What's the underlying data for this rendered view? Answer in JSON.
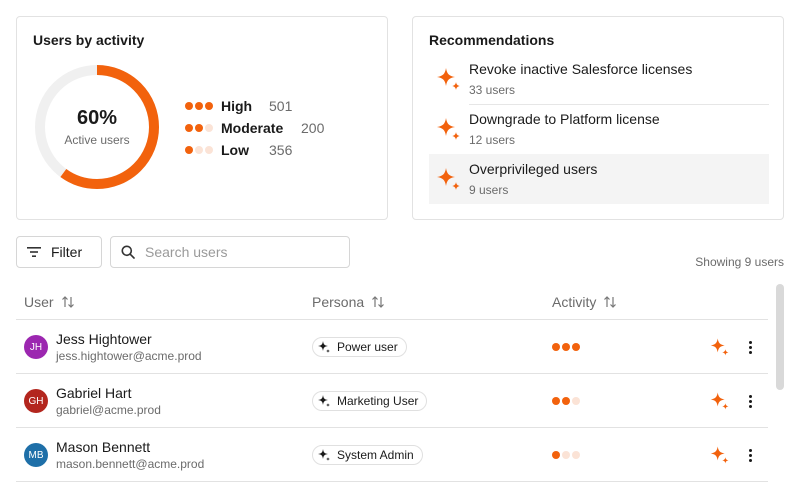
{
  "activity_card": {
    "title": "Users by activity",
    "donut_value": "60%",
    "donut_caption": "Active users",
    "active_fraction": 0.6,
    "legend": [
      {
        "label": "High",
        "count": "501",
        "level": 3
      },
      {
        "label": "Moderate",
        "count": "200",
        "level": 2
      },
      {
        "label": "Low",
        "count": "356",
        "level": 1
      }
    ]
  },
  "recommendations": {
    "title": "Recommendations",
    "items": [
      {
        "title": "Revoke inactive Salesforce licenses",
        "subtitle": "33 users",
        "selected": false
      },
      {
        "title": "Downgrade to Platform license",
        "subtitle": "12 users",
        "selected": false
      },
      {
        "title": "Overprivileged users",
        "subtitle": "9 users",
        "selected": true
      }
    ]
  },
  "toolbar": {
    "filter_label": "Filter",
    "search_placeholder": "Search users",
    "search_value": "",
    "showing_text": "Showing 9 users"
  },
  "table": {
    "columns": [
      "User",
      "Persona",
      "Activity"
    ],
    "rows": [
      {
        "initials": "JH",
        "name": "Jess Hightower",
        "email": "jess.hightower@acme.prod",
        "persona": "Power user",
        "activity_level": 3,
        "avatar_color": "#9c27b0"
      },
      {
        "initials": "GH",
        "name": "Gabriel Hart",
        "email": "gabriel@acme.prod",
        "persona": "Marketing User",
        "activity_level": 2,
        "avatar_color": "#b3261e"
      },
      {
        "initials": "MB",
        "name": "Mason Bennett",
        "email": "mason.bennett@acme.prod",
        "persona": "System Admin",
        "activity_level": 1,
        "avatar_color": "#1e6fa8"
      }
    ]
  },
  "colors": {
    "accent": "#f2620d",
    "accent_light": "#fbe3d6",
    "track": "#f0f0f0"
  },
  "icons": {
    "recommendation": "sparkle-icon",
    "filter": "filter-lines-icon",
    "search": "search-icon",
    "sort": "sort-arrows-icon",
    "persona": "sparkle-outline-icon",
    "row_action": "sparkle-icon",
    "row_menu": "kebab-menu-icon"
  }
}
